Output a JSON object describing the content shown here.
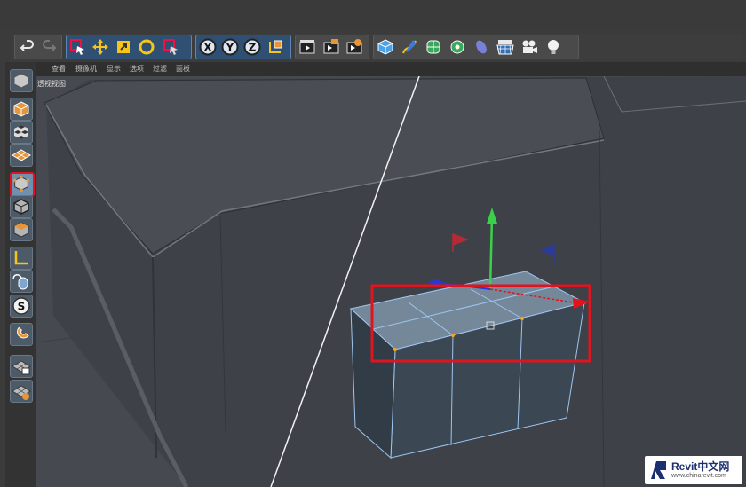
{
  "menu": {
    "items": [
      {
        "label": "查看"
      },
      {
        "label": "摄像机"
      },
      {
        "label": "显示"
      },
      {
        "label": "选项"
      },
      {
        "label": "过滤"
      },
      {
        "label": "面板"
      }
    ]
  },
  "toolbar": {
    "axis_labels": [
      "X",
      "Y",
      "Z"
    ]
  },
  "viewport": {
    "label": "透视视图"
  },
  "watermark": {
    "brand": "Revit中文网",
    "url": "www.chinarevit.com"
  },
  "colors": {
    "accent_blue": "#5b86b8",
    "selection_box": "#e0141e",
    "axis_y": "#3ad14a",
    "axis_x": "#e0141e",
    "axis_z": "#2838d8"
  }
}
